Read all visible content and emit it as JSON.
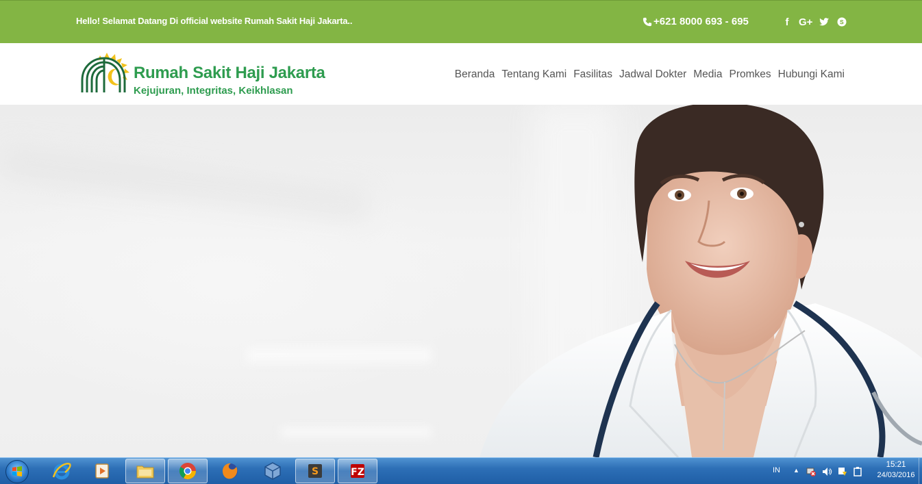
{
  "topbar": {
    "greeting": "Hello! Selamat Datang Di official website Rumah Sakit Haji Jakarta..",
    "phone": "+621 8000 693 - 695",
    "social": [
      {
        "name": "facebook",
        "label": "f"
      },
      {
        "name": "google-plus",
        "label": "G+"
      },
      {
        "name": "twitter",
        "label": ""
      },
      {
        "name": "skype",
        "label": ""
      }
    ],
    "background_color": "#83b544"
  },
  "header": {
    "logo_title": "Rumah Sakit Haji Jakarta",
    "logo_tagline": "Kejujuran, Integritas, Keikhlasan",
    "brand_color": "#2e9c4f",
    "nav": [
      {
        "label": "Beranda"
      },
      {
        "label": "Tentang Kami"
      },
      {
        "label": "Fasilitas"
      },
      {
        "label": "Jadwal Dokter"
      },
      {
        "label": "Media"
      },
      {
        "label": "Promkes"
      },
      {
        "label": "Hubungi Kami"
      }
    ]
  },
  "hero": {
    "image": "smiling female doctor with stethoscope in hospital corridor"
  },
  "taskbar": {
    "apps": [
      {
        "name": "internet-explorer",
        "active": false
      },
      {
        "name": "media-player",
        "active": false
      },
      {
        "name": "file-explorer",
        "active": true
      },
      {
        "name": "chrome",
        "active": true
      },
      {
        "name": "firefox",
        "active": false
      },
      {
        "name": "virtualbox",
        "active": false
      },
      {
        "name": "sublime-text",
        "active": true
      },
      {
        "name": "filezilla",
        "active": true
      }
    ],
    "tray": {
      "language": "IN",
      "time": "15:21",
      "date": "24/03/2016"
    }
  }
}
